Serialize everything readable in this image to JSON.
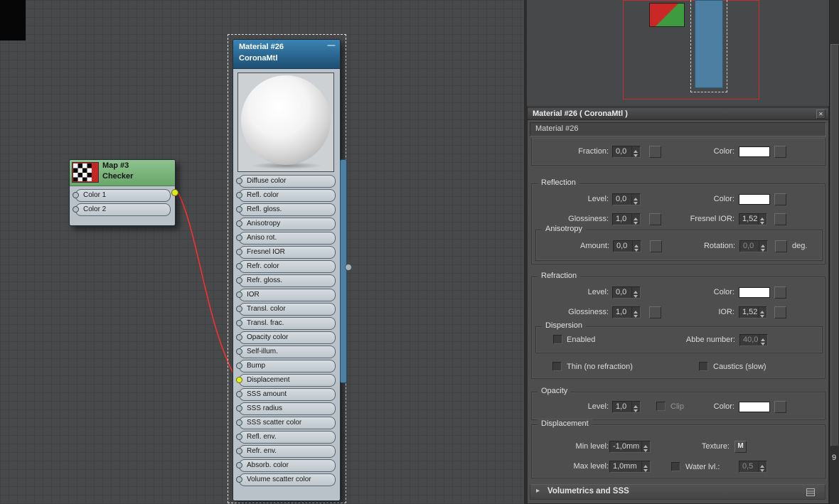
{
  "colors": {
    "material_header_blue": "#2e74a2",
    "map_header_green": "#7cb77c",
    "checker_thumb_red": "#c92525",
    "connection_red": "#ff2d2d",
    "connected_pin_yellow": "#e3ee1d",
    "navigator_node_blue": "#4d7fa3",
    "navigator_frame_red": "#c03030",
    "swatch_white": "#ffffff"
  },
  "canvas": {
    "checker_node": {
      "title": "Map #3",
      "subtitle": "Checker",
      "slots": [
        {
          "label": "Color 1",
          "connected": false
        },
        {
          "label": "Color 2",
          "connected": false
        }
      ]
    },
    "material_node": {
      "title": "Material #26",
      "subtitle": "CoronaMtl",
      "minimize": "—",
      "slots": [
        {
          "label": "Diffuse color",
          "connected": false
        },
        {
          "label": "Refl. color",
          "connected": false
        },
        {
          "label": "Refl. gloss.",
          "connected": false
        },
        {
          "label": "Anisotropy",
          "connected": false
        },
        {
          "label": "Aniso rot.",
          "connected": false
        },
        {
          "label": "Fresnel IOR",
          "connected": false
        },
        {
          "label": "Refr. color",
          "connected": false
        },
        {
          "label": "Refr. gloss.",
          "connected": false
        },
        {
          "label": "IOR",
          "connected": false
        },
        {
          "label": "Transl. color",
          "connected": false
        },
        {
          "label": "Transl. frac.",
          "connected": false
        },
        {
          "label": "Opacity color",
          "connected": false
        },
        {
          "label": "Self-illum.",
          "connected": false
        },
        {
          "label": "Bump",
          "connected": false
        },
        {
          "label": "Displacement",
          "connected": true
        },
        {
          "label": "SSS amount",
          "connected": false
        },
        {
          "label": "SSS radius",
          "connected": false
        },
        {
          "label": "SSS scatter color",
          "connected": false
        },
        {
          "label": "Refl. env.",
          "connected": false
        },
        {
          "label": "Refr. env.",
          "connected": false
        },
        {
          "label": "Absorb. color",
          "connected": false
        },
        {
          "label": "Volume scatter color",
          "connected": false
        }
      ]
    }
  },
  "panel": {
    "titlebar": {
      "title": "Material #26  ( CoronaMtl )",
      "close": "✕"
    },
    "name_field": "Material #26",
    "top_row": {
      "fraction_label": "Fraction:",
      "fraction_value": "0,0",
      "color_label": "Color:"
    },
    "reflection": {
      "title": "Reflection",
      "level_label": "Level:",
      "level_value": "0,0",
      "color_label": "Color:",
      "glossiness_label": "Glossiness:",
      "glossiness_value": "1,0",
      "fresnel_ior_label": "Fresnel IOR:",
      "fresnel_ior_value": "1,52",
      "anisotropy_title": "Anisotropy",
      "amount_label": "Amount:",
      "amount_value": "0,0",
      "rotation_label": "Rotation:",
      "rotation_value": "0,0",
      "deg_label": "deg."
    },
    "refraction": {
      "title": "Refraction",
      "level_label": "Level:",
      "level_value": "0,0",
      "color_label": "Color:",
      "glossiness_label": "Glossiness:",
      "glossiness_value": "1,0",
      "ior_label": "IOR:",
      "ior_value": "1,52",
      "dispersion_title": "Dispersion",
      "enabled_label": "Enabled",
      "abbe_label": "Abbe number:",
      "abbe_value": "40,0",
      "thin_label": "Thin (no refraction)",
      "caustics_label": "Caustics (slow)"
    },
    "opacity": {
      "title": "Opacity",
      "level_label": "Level:",
      "level_value": "1,0",
      "clip_label": "Clip",
      "color_label": "Color:"
    },
    "displacement": {
      "title": "Displacement",
      "min_label": "Min level:",
      "min_value": "-1,0mm",
      "texture_label": "Texture:",
      "texture_button": "M",
      "max_label": "Max level:",
      "max_value": "1,0mm",
      "water_label": "Water lvl.:",
      "water_value": "0,5"
    },
    "volumetrics": {
      "arrow": "▸",
      "title": "Volumetrics and SSS"
    }
  },
  "scrollbar": {
    "page_label": "9"
  }
}
